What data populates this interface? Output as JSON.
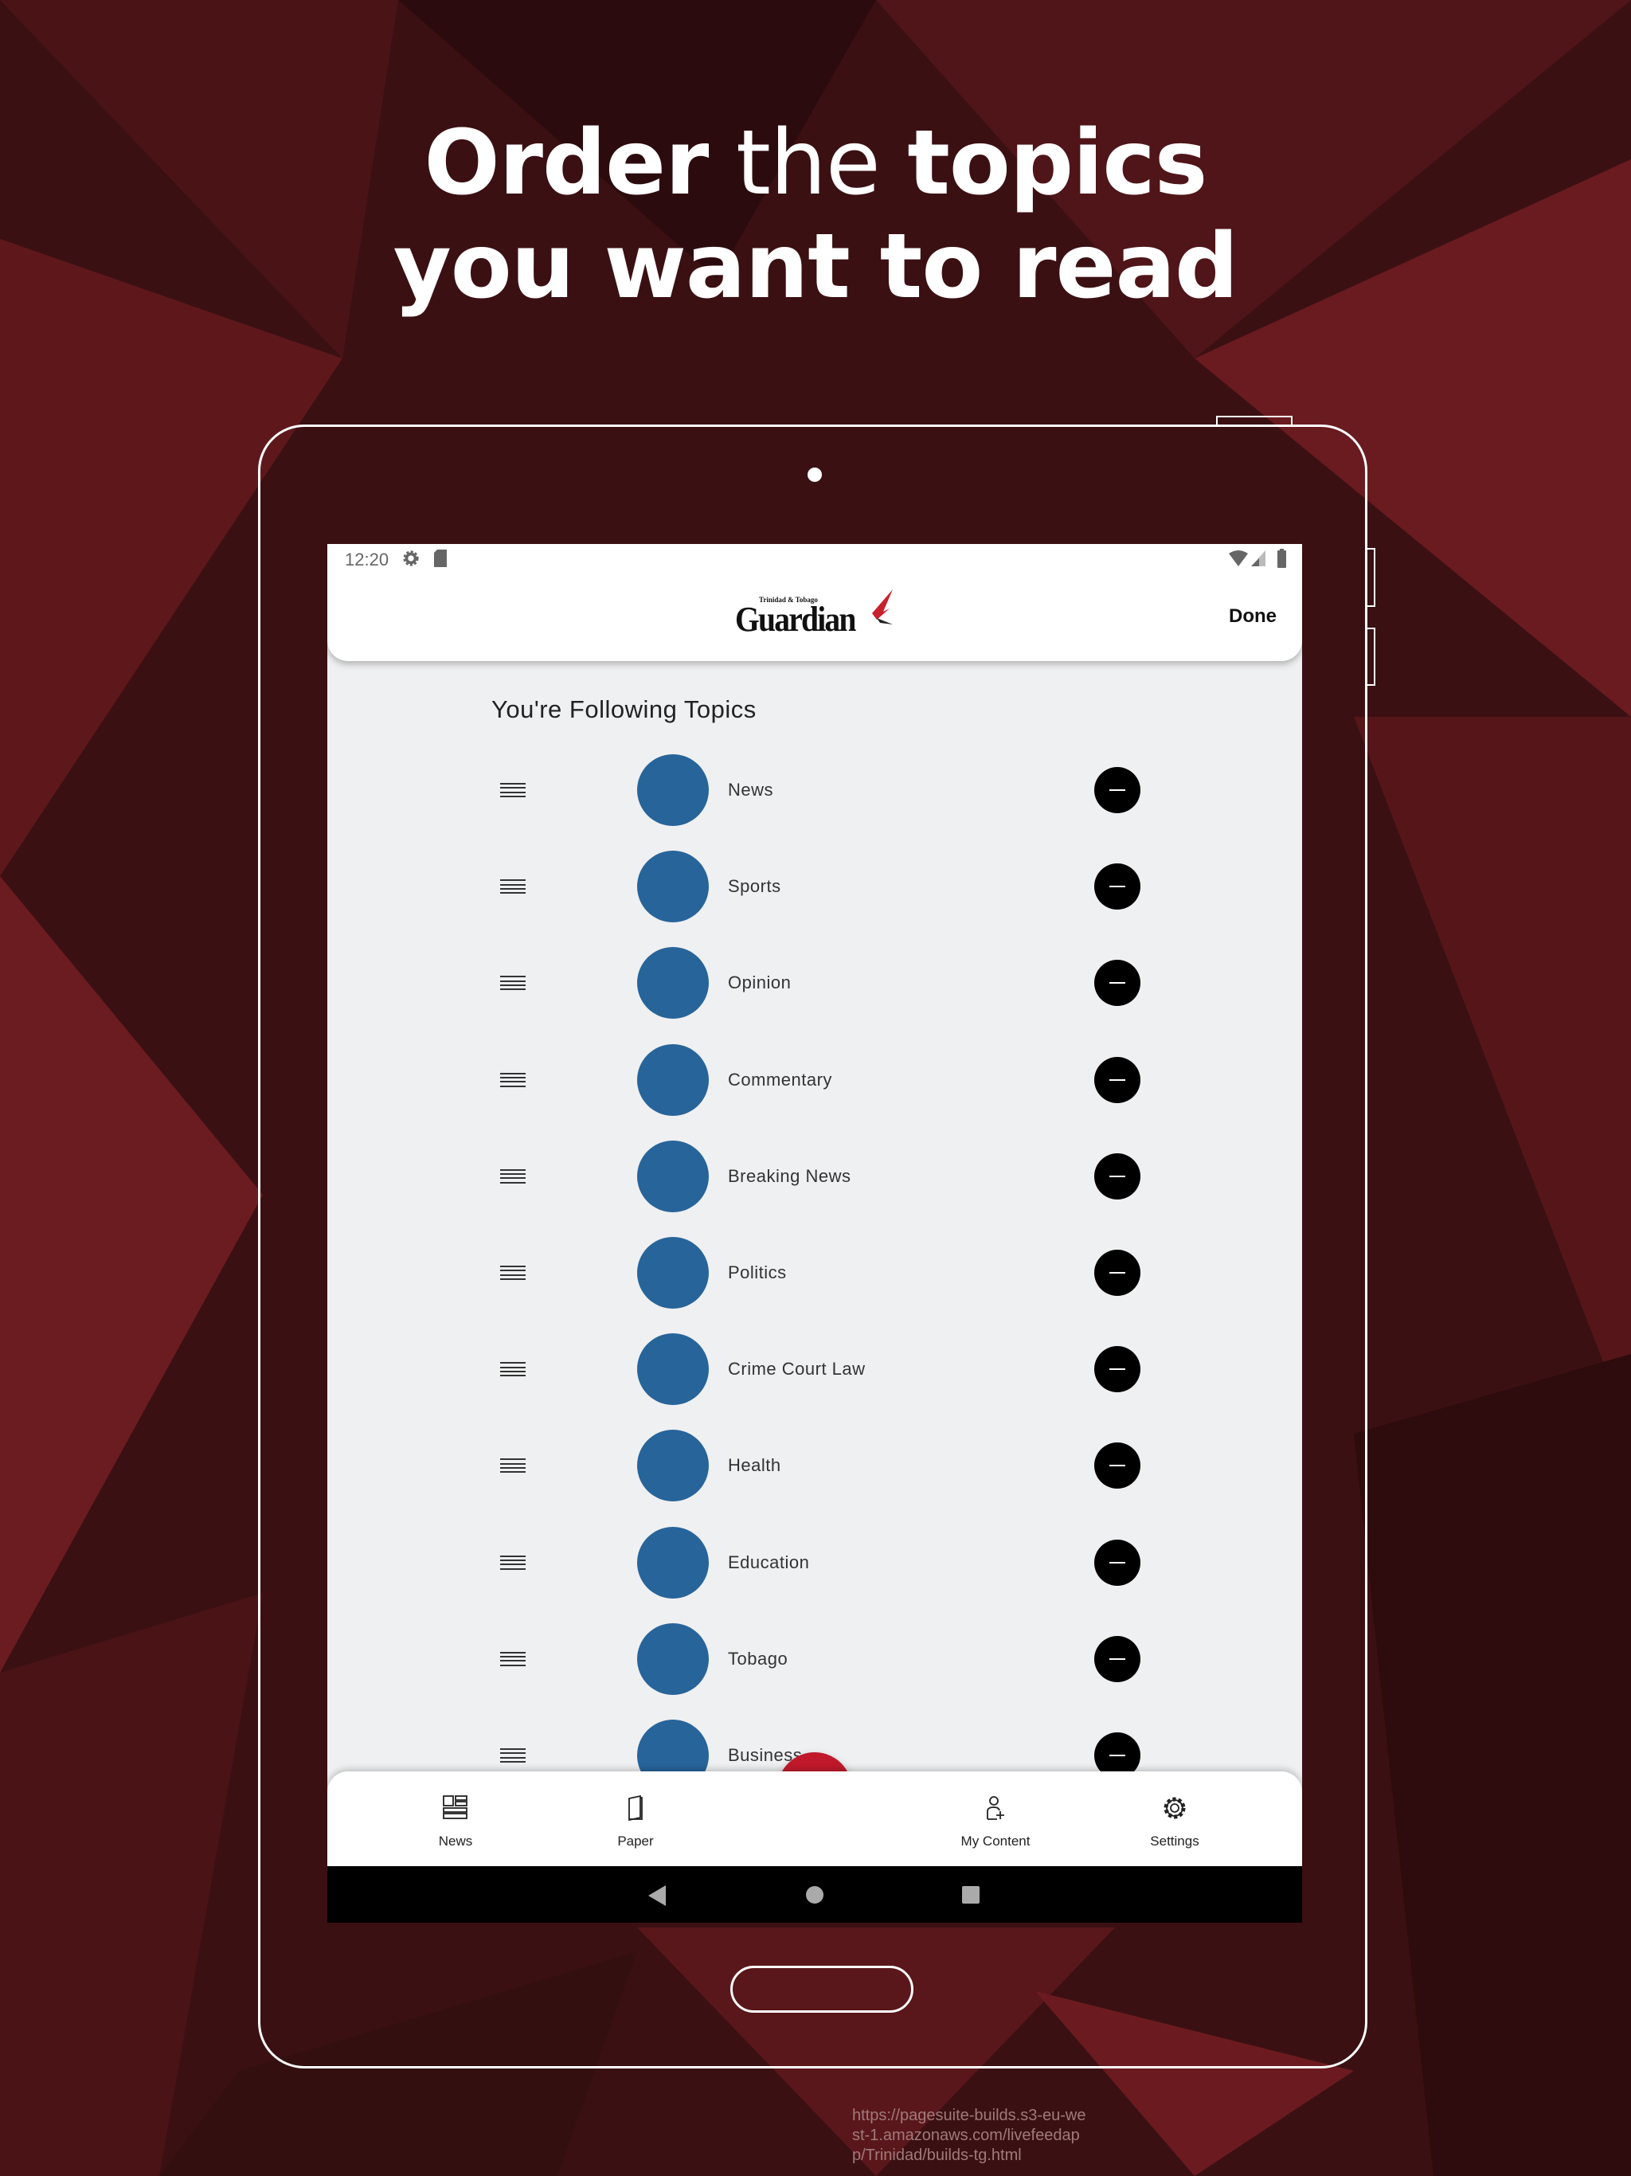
{
  "headline": {
    "line1_bold1": "Order",
    "line1_thin": " the ",
    "line1_bold2": "topics",
    "line2": "you want to read"
  },
  "status_bar": {
    "time": "12:20",
    "icons": [
      "gear-icon",
      "sd-card-icon",
      "wifi-icon",
      "signal-icon",
      "battery-icon"
    ]
  },
  "app_bar": {
    "logo_text": "Guardian",
    "logo_subtext": "Trinidad & Tobago",
    "done_label": "Done"
  },
  "section_title": "You're Following Topics",
  "topics": [
    {
      "label": "News"
    },
    {
      "label": "Sports"
    },
    {
      "label": "Opinion"
    },
    {
      "label": "Commentary"
    },
    {
      "label": "Breaking News"
    },
    {
      "label": "Politics"
    },
    {
      "label": "Crime Court Law"
    },
    {
      "label": "Health"
    },
    {
      "label": "Education"
    },
    {
      "label": "Tobago"
    },
    {
      "label": "Business"
    }
  ],
  "bottom_nav": {
    "items": [
      {
        "label": "News",
        "icon": "news-icon"
      },
      {
        "label": "Paper",
        "icon": "paper-icon"
      },
      {
        "label": "My Content",
        "icon": "add-user-icon"
      },
      {
        "label": "Settings",
        "icon": "gear-icon"
      }
    ],
    "fab_icon": "close-icon"
  },
  "url_text": "https://pagesuite-builds.s3-eu-west-1.amazonaws.com/livefeedapp/Trinidad/builds-tg.html",
  "colors": {
    "accent": "#c0192b",
    "topic_circle": "#27649a",
    "background": "#3a0f12"
  }
}
